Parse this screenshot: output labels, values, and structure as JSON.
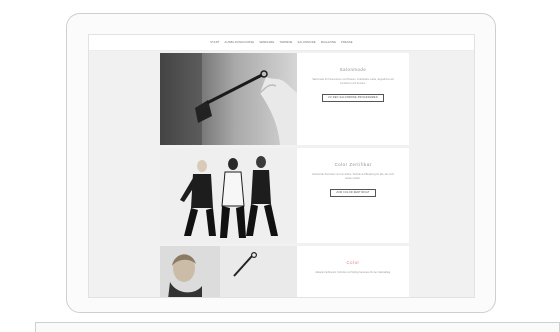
{
  "nav": {
    "items": [
      "Start",
      "Ausbildung/Kurse",
      "Seminare",
      "Termine",
      "Salonmode",
      "Magazine",
      "Presse"
    ]
  },
  "sections": [
    {
      "title": "Salonmode",
      "text": "Salonmode für Friseurinnen und Friseure. Individuelle Looks, abgestimmt auf Kundinnen und Kunden.",
      "button": "Zu den Salonmode Programmen"
    },
    {
      "title": "Color Zertifikat",
      "text": "Vertiefende Seminare rund um Farbe, Technik und Beratung für alle, die mehr wissen wollen.",
      "button": "Zum Color Zertifikat"
    },
    {
      "title": "Color",
      "text": "Aktuelle Farbtrends, Schnitte und Styling-Seminare für den Salonalltag."
    }
  ],
  "colors": {
    "accent_title": "#e07b7b",
    "muted_title": "#8a8a8a"
  }
}
